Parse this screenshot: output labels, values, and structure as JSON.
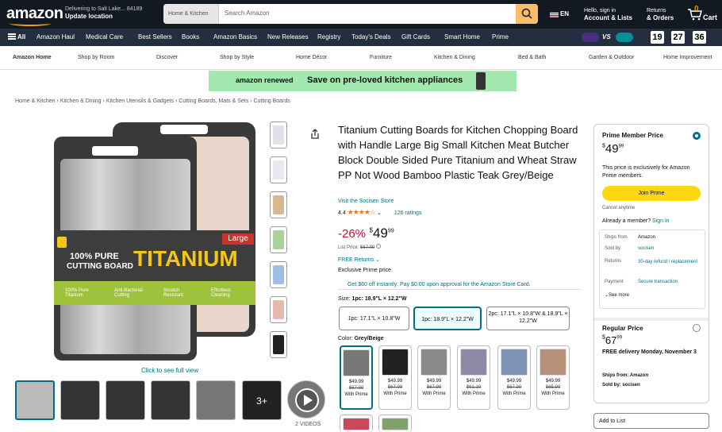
{
  "header": {
    "logo": "amazon",
    "deliver_line1": "Delivering to Salt Lake... 84189",
    "deliver_line2": "Update location",
    "search_dept": "Home & Kitchen",
    "search_placeholder": "Search Amazon",
    "lang": "EN",
    "account_line1": "Hello, sign in",
    "account_line2": "Account & Lists",
    "returns_line1": "Returns",
    "returns_line2": "& Orders",
    "cart_count": "0",
    "cart_label": "Cart"
  },
  "subnav": {
    "all": "All",
    "items": [
      "Amazon Haul",
      "Medical Care",
      "Best Sellers",
      "Books",
      "Amazon Basics",
      "New Releases",
      "Registry",
      "Today's Deals",
      "Gift Cards",
      "Smart Home",
      "Prime"
    ],
    "game_vs": "VS",
    "timer": [
      "19",
      "27",
      "36"
    ]
  },
  "categories": [
    "Amazon Home",
    "Shop by Room",
    "Discover",
    "Shop by Style",
    "Home Décor",
    "Furniture",
    "Kitchen & Dining",
    "Bed & Bath",
    "Garden & Outdoor",
    "Home Improvement"
  ],
  "banner": {
    "brand": "amazon renewed",
    "text": "Save on pre-loved kitchen appliances"
  },
  "breadcrumb": [
    "Home & Kitchen",
    "Kitchen & Dining",
    "Kitchen Utensils & Gadgets",
    "Cutting Boards, Mats & Sets",
    "Cutting Boards"
  ],
  "gallery": {
    "badge": "Large",
    "line1": "100% PURE",
    "line2": "CUTTING BOARD",
    "big": "TITANIUM",
    "features": [
      "100% Pure Titanium",
      "Anti-Bacterial Cutting",
      "Scratch Resistant",
      "Effortless Cleaning"
    ],
    "caption": "Click to see full view",
    "videos": "2 VIDEOS",
    "more": "3+"
  },
  "product": {
    "title": "Titanium Cutting Boards for Kitchen Chopping Board with Handle Large Big Small Kitchen Meat Butcher Block Double Sided Pure Titanium and Wheat Straw PP Not Wood Bamboo Plastic Teak Grey/Beige",
    "store": "Visit the Socisen Store",
    "rating": "4.4",
    "ratings_count": "126 ratings",
    "discount": "-26%",
    "price_symbol": "$",
    "price_whole": "49",
    "price_frac": "99",
    "list_label": "List Price:",
    "list_price": "$67.99",
    "free_returns": "FREE Returns",
    "exclusive": "Exclusive Prime price",
    "card_offer": "Get $60 off instantly: Pay $0.00 upon approval for the Amazon Store Card.",
    "size_label": "Size:",
    "size_value": "1pc: 18.9\"L × 12.2\"W",
    "sizes": [
      "1pc: 17.1\"L × 10.8\"W",
      "1pc: 18.9\"L × 12.2\"W",
      "2pc: 17.1\"L × 10.8\"W & 18.9\"L × 12.2\"W"
    ],
    "color_label": "Color:",
    "color_value": "Grey/Beige",
    "swatches": [
      {
        "price": "$49.99",
        "old": "$67.99",
        "tag": "With Prime"
      },
      {
        "price": "$49.99",
        "old": "$67.99",
        "tag": "With Prime"
      },
      {
        "price": "$49.99",
        "old": "$67.99",
        "tag": "With Prime"
      },
      {
        "price": "$49.99",
        "old": "$61.19",
        "tag": "With Prime"
      },
      {
        "price": "$49.99",
        "old": "$67.99",
        "tag": "With Prime"
      },
      {
        "price": "$49.99",
        "old": "$65.99",
        "tag": "With Prime"
      }
    ]
  },
  "buybox": {
    "prime_label": "Prime Member Price",
    "price_symbol": "$",
    "price_whole": "49",
    "price_frac": "99",
    "exclusive": "This price is exclusively for Amazon Prime members.",
    "join": "Join Prime",
    "cancel": "Cancel anytime",
    "already": "Already a member?",
    "signin": "Sign in",
    "rows": [
      {
        "k": "Ships from",
        "v": "Amazon"
      },
      {
        "k": "Sold by",
        "v": "socisen"
      },
      {
        "k": "Returns",
        "v": "30-day refund / replacement"
      },
      {
        "k": "Payment",
        "v": "Secure transaction"
      }
    ],
    "see_more": "See more",
    "regular_label": "Regular Price",
    "reg_symbol": "$",
    "reg_whole": "67",
    "reg_frac": "99",
    "delivery": "FREE delivery Monday, November 3",
    "ships": "Ships from: Amazon",
    "sold": "Sold by: socisen",
    "add_list": "Add to List"
  },
  "colors": {
    "nav": "#131921",
    "subnav": "#232f3e",
    "accent": "#febd69",
    "discount": "#cc0c39",
    "link": "#007185",
    "join": "#ffd814",
    "banner": "#a3e8ae"
  }
}
